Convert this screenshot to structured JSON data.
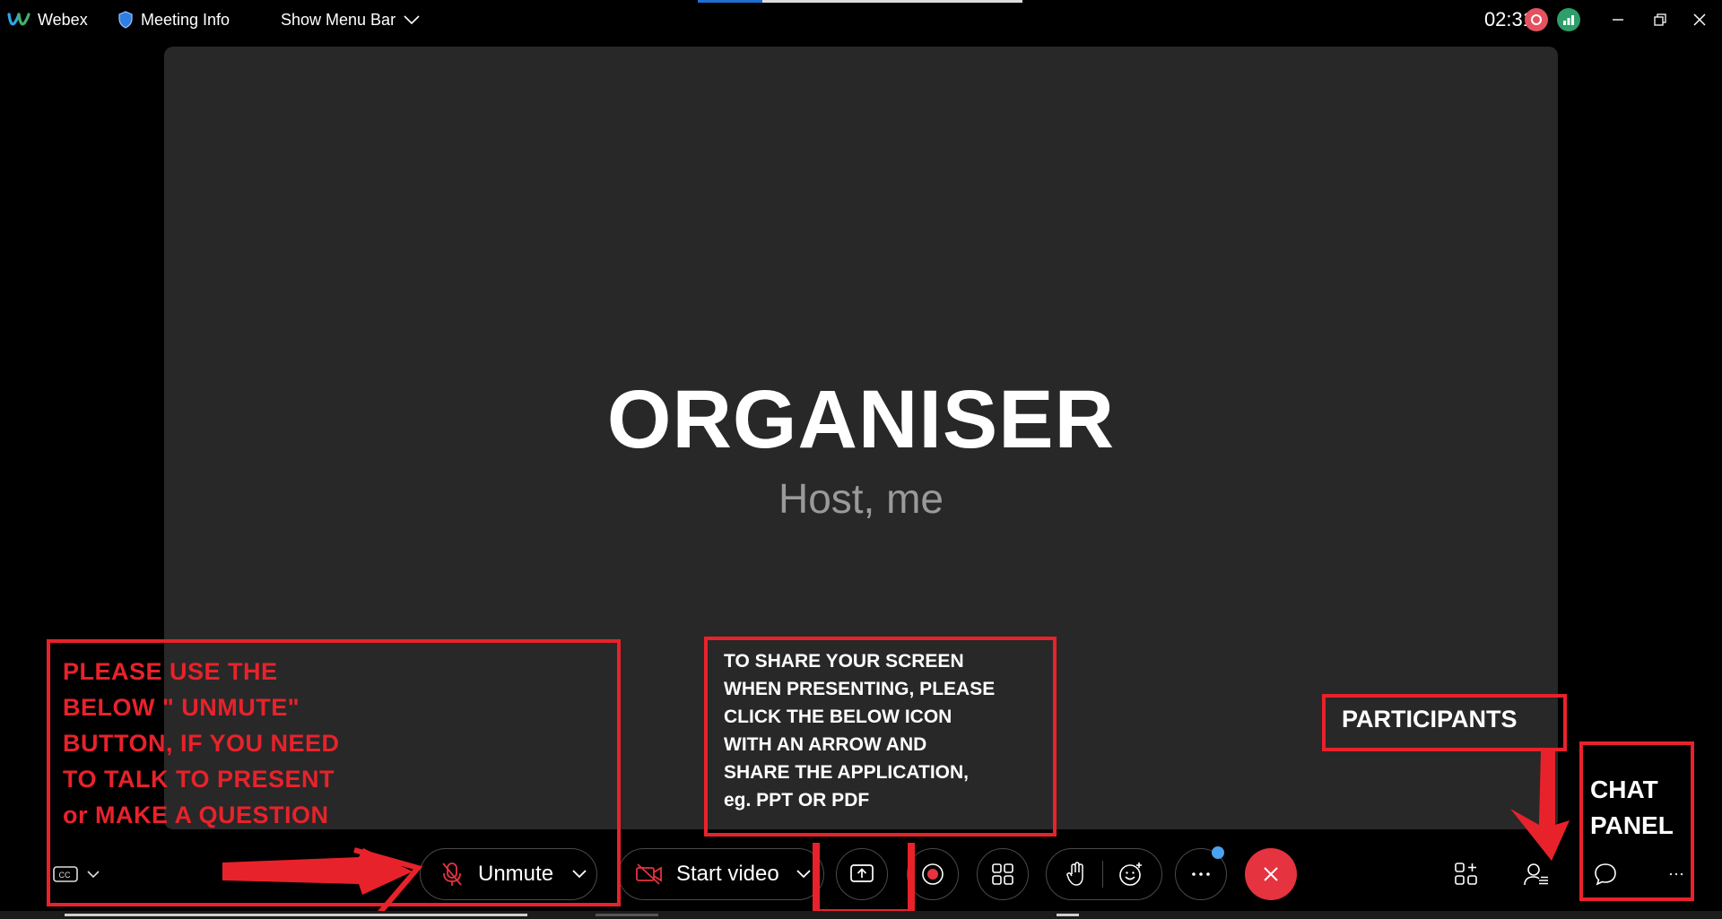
{
  "topbar": {
    "app_name": "Webex",
    "meeting_info": "Meeting Info",
    "show_menu_bar": "Show Menu Bar",
    "clock": "02:31",
    "loading_progress_percent": 20
  },
  "stage": {
    "name": "ORGANISER",
    "role": "Host, me"
  },
  "controls": {
    "unmute_label": "Unmute",
    "start_video_label": "Start video",
    "more_has_notification": true
  },
  "annotations": {
    "unmute_note": [
      "PLEASE USE THE",
      "BELOW \" UNMUTE\"",
      "BUTTON, IF YOU NEED",
      "TO TALK TO PRESENT",
      "or MAKE A QUESTION"
    ],
    "share_note": [
      "TO SHARE YOUR SCREEN",
      "WHEN PRESENTING, PLEASE",
      "CLICK THE BELOW ICON",
      "WITH AN ARROW AND",
      "SHARE THE APPLICATION,",
      "eg. PPT OR PDF"
    ],
    "participants_label": "PARTICIPANTS",
    "chat_label_line1": "CHAT",
    "chat_label_line2": "PANEL"
  },
  "colors": {
    "annotation_red": "#e8222b",
    "end_call_red": "#e5333f",
    "stage_bg": "#282828",
    "recording_badge": "#e5525f",
    "network_badge": "#2e9e6a",
    "progress_blue": "#1f6fd1"
  },
  "icons": [
    "webex-logo-icon",
    "shield-icon",
    "chevron-down-icon",
    "recording-icon",
    "signal-icon",
    "minimize-icon",
    "restore-icon",
    "close-icon",
    "captions-icon",
    "mic-off-icon",
    "video-off-icon",
    "share-screen-icon",
    "record-icon",
    "layout-grid-icon",
    "raise-hand-icon",
    "reactions-icon",
    "more-icon",
    "end-call-icon",
    "apps-icon",
    "participants-icon",
    "chat-icon"
  ]
}
